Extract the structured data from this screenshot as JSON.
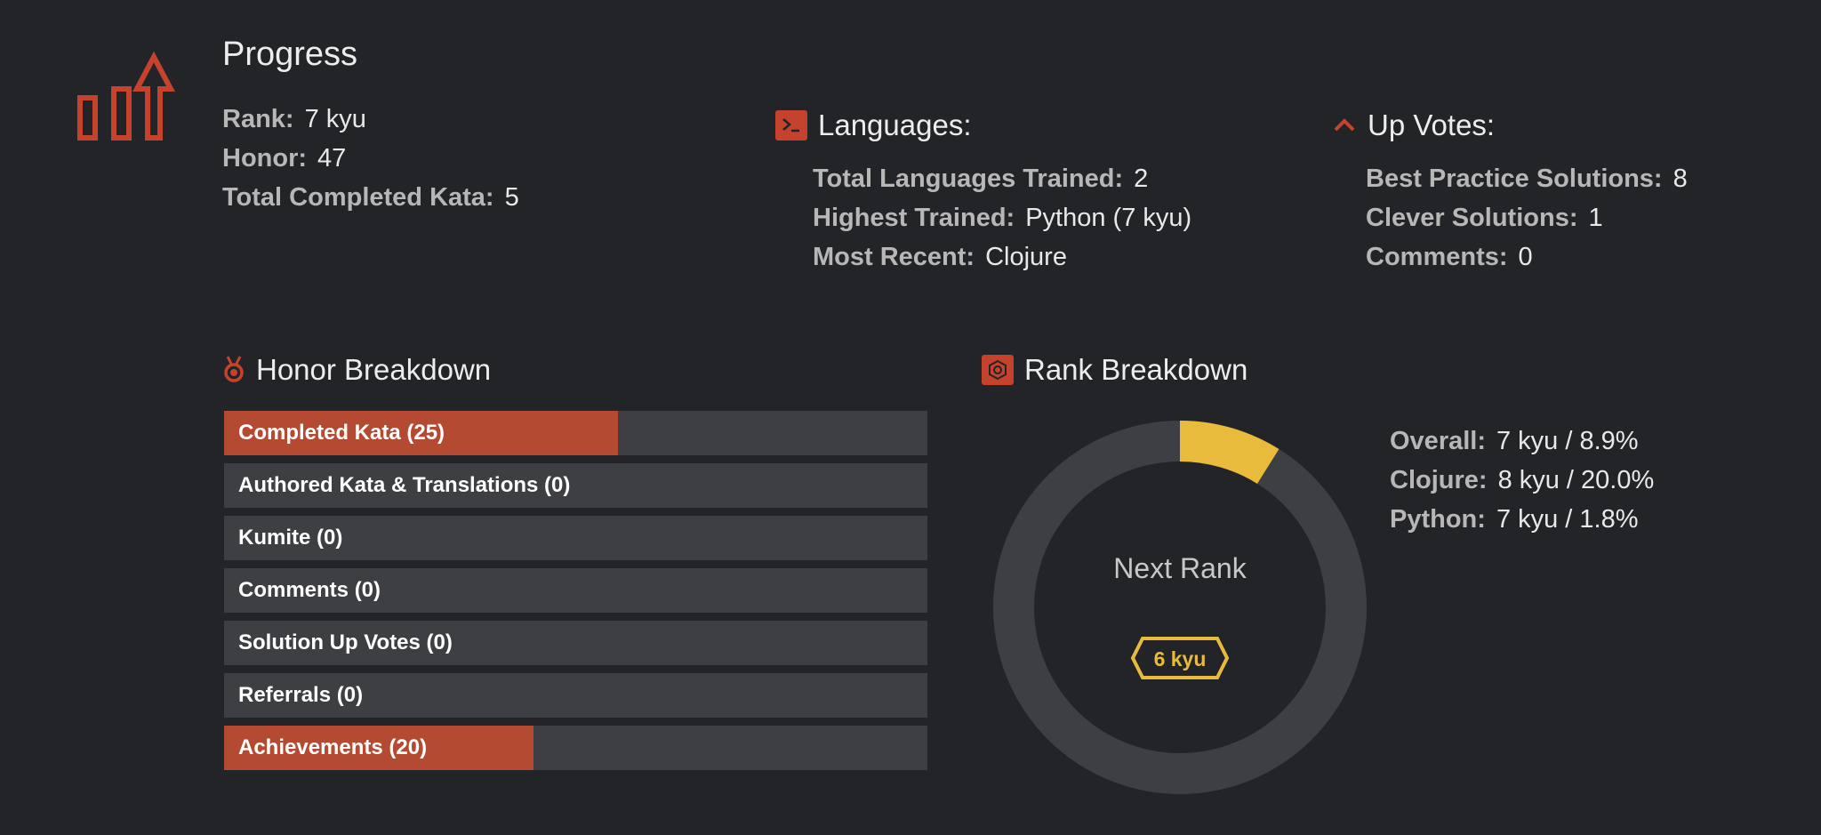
{
  "progress": {
    "title": "Progress",
    "stats": [
      {
        "key": "Rank:",
        "value": "7 kyu"
      },
      {
        "key": "Honor:",
        "value": "47"
      },
      {
        "key": "Total Completed Kata:",
        "value": "5"
      }
    ]
  },
  "languages": {
    "title": "Languages:",
    "stats": [
      {
        "key": "Total Languages Trained:",
        "value": "2"
      },
      {
        "key": "Highest Trained:",
        "value": "Python (7 kyu)"
      },
      {
        "key": "Most Recent:",
        "value": "Clojure"
      }
    ]
  },
  "upvotes": {
    "title": "Up Votes:",
    "stats": [
      {
        "key": "Best Practice Solutions:",
        "value": "8"
      },
      {
        "key": "Clever Solutions:",
        "value": "1"
      },
      {
        "key": "Comments:",
        "value": "0"
      }
    ]
  },
  "honor_breakdown": {
    "title": "Honor Breakdown",
    "bars": [
      {
        "label": "Completed Kata (25)",
        "fill_fraction": 0.56
      },
      {
        "label": "Authored Kata & Translations (0)",
        "fill_fraction": 0
      },
      {
        "label": "Kumite (0)",
        "fill_fraction": 0
      },
      {
        "label": "Comments (0)",
        "fill_fraction": 0
      },
      {
        "label": "Solution Up Votes (0)",
        "fill_fraction": 0
      },
      {
        "label": "Referrals (0)",
        "fill_fraction": 0
      },
      {
        "label": "Achievements (20)",
        "fill_fraction": 0.44
      }
    ]
  },
  "rank_breakdown": {
    "title": "Rank Breakdown",
    "next_rank_label": "Next Rank",
    "next_rank_badge": "6 kyu",
    "progress_fraction": 0.089,
    "stats": [
      {
        "key": "Overall:",
        "value": "7 kyu / 8.9%"
      },
      {
        "key": "Clojure:",
        "value": "8 kyu / 20.0%"
      },
      {
        "key": "Python:",
        "value": "7 kyu / 1.8%"
      }
    ]
  },
  "colors": {
    "accent": "#c5432d",
    "bar_fill": "#b54a33",
    "bar_track": "#3e3f42",
    "donut_progress": "#e8bb3c",
    "donut_track": "#3e3f42",
    "background": "#232427"
  },
  "icons": {
    "progress": "bar-chart-up-arrow-icon",
    "languages": "terminal-icon",
    "upvotes": "chevron-up-icon",
    "honor": "medal-icon",
    "rank": "hexagon-icon"
  }
}
